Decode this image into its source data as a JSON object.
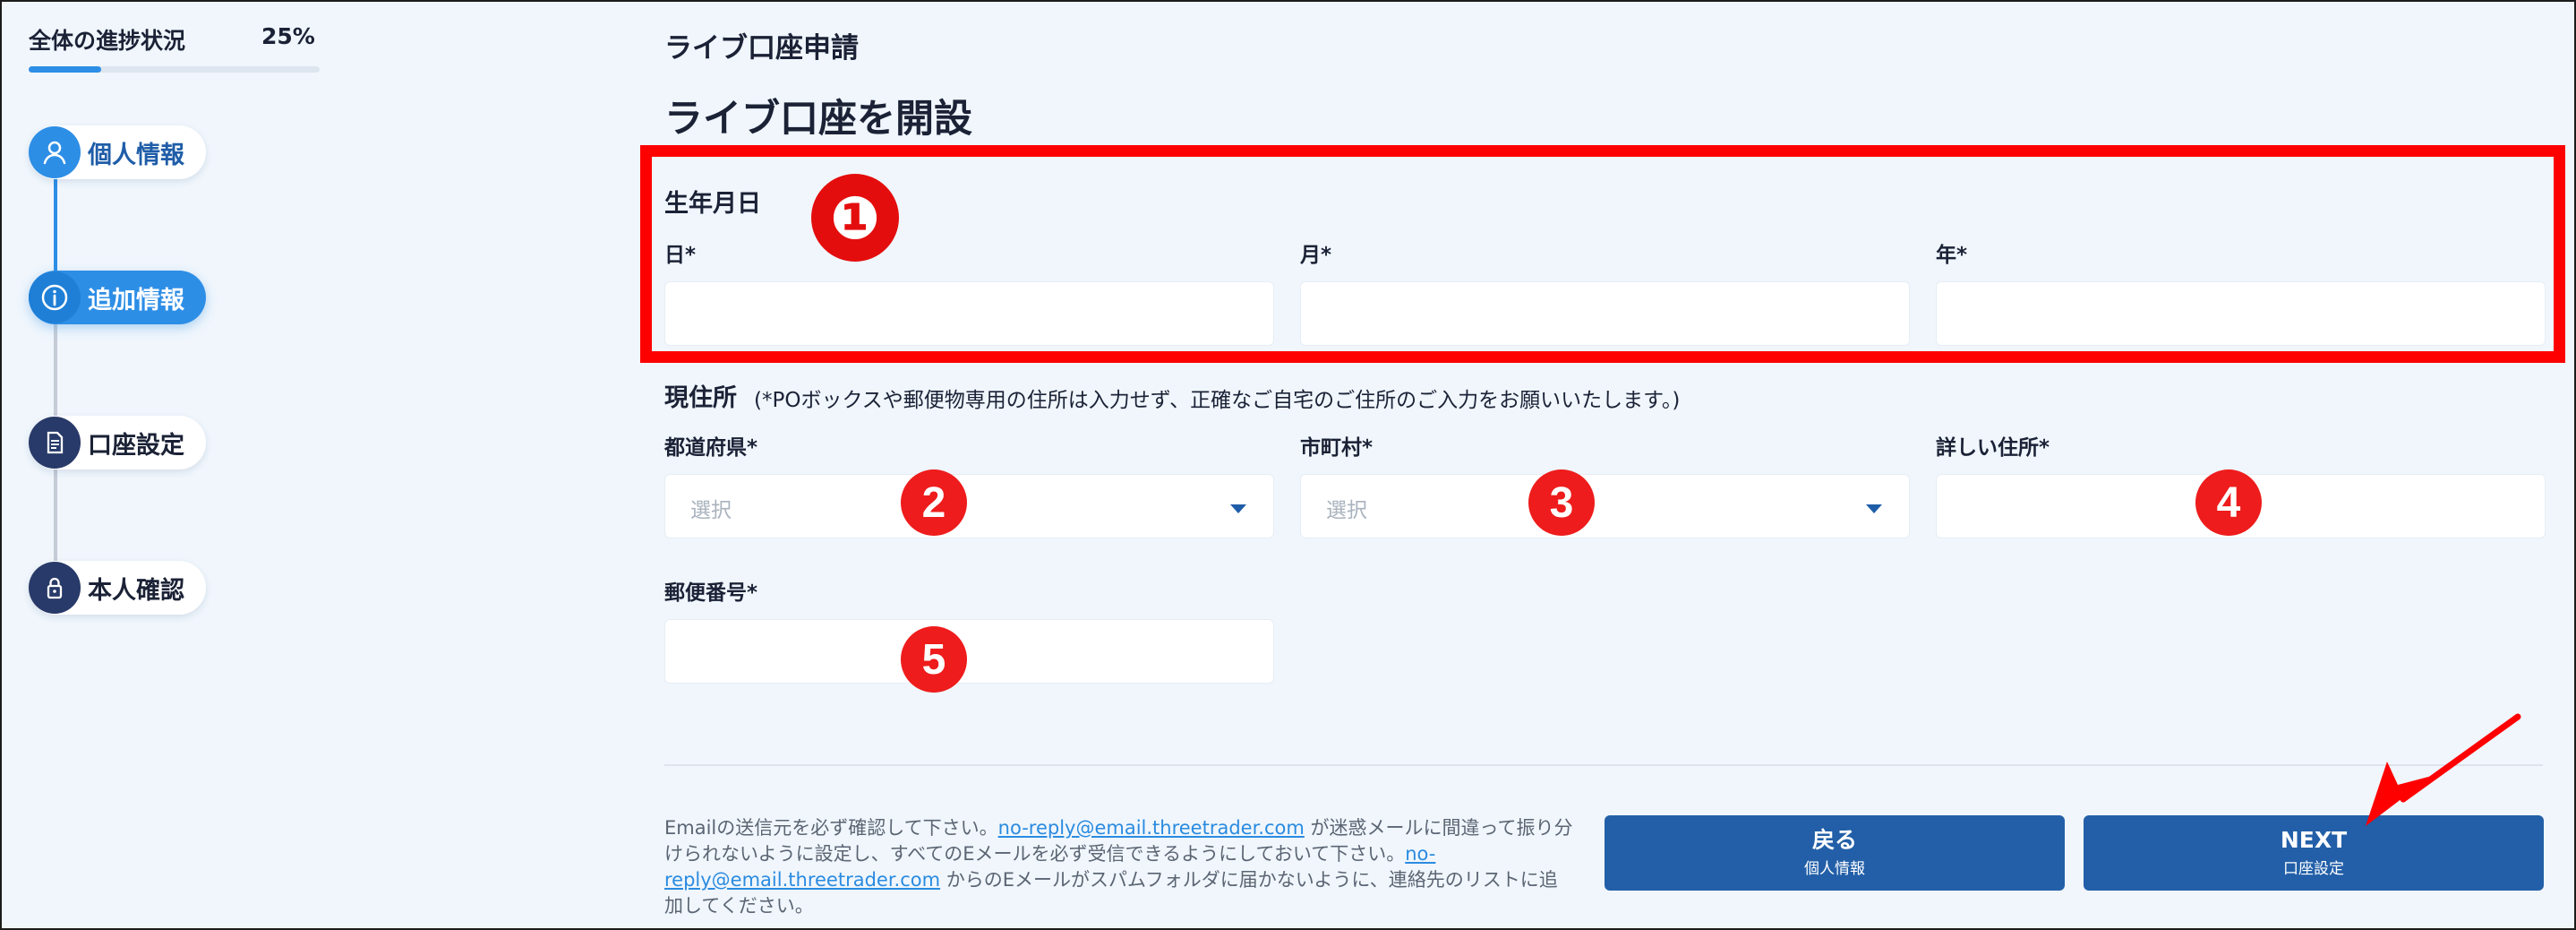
{
  "sidebar": {
    "progress_label": "全体の進捗状況",
    "progress_value": "25%",
    "progress_fraction": 0.25,
    "steps": [
      {
        "label": "個人情報",
        "icon": "user-icon",
        "state": "completed"
      },
      {
        "label": "追加情報",
        "icon": "info-icon",
        "state": "active"
      },
      {
        "label": "口座設定",
        "icon": "document-icon",
        "state": "pending"
      },
      {
        "label": "本人確認",
        "icon": "lock-icon",
        "state": "pending"
      }
    ]
  },
  "main": {
    "breadcrumb": "ライブ口座申請",
    "title": "ライブ口座を開設",
    "birthdate": {
      "section_label": "生年月日",
      "day_label": "日*",
      "month_label": "月*",
      "year_label": "年*",
      "day_value": "",
      "month_value": "",
      "year_value": ""
    },
    "address": {
      "section_label": "現住所",
      "note": "(*POボックスや郵便物専用の住所は入力せず、正確なご自宅のご住所のご入力をお願いいたします。)",
      "prefecture_label": "都道府県*",
      "prefecture_value": "選択",
      "city_label": "市町村*",
      "city_value": "選択",
      "detail_label": "詳しい住所*",
      "detail_value": "",
      "postal_label": "郵便番号*",
      "postal_value": ""
    },
    "markers": [
      "❶",
      "2",
      "3",
      "4",
      "5"
    ]
  },
  "footer": {
    "note_part1": "Emailの送信元を必ず確認して下さい。",
    "email_link_1": "no-reply@email.threetrader.com",
    "note_part2": " が迷惑メールに間違って振り分けられないように設定し、すべてのEメールを必ず受信できるようにしておいて下さい。",
    "email_link_2": "no-reply@email.threetrader.com",
    "note_part3": " からのEメールがスパムフォルダに届かないように、連絡先のリストに追加してください。",
    "back_button": {
      "main": "戻る",
      "sub": "個人情報"
    },
    "next_button": {
      "main": "NEXT",
      "sub": "口座設定"
    }
  },
  "colors": {
    "accent": "#2d8ee6",
    "button": "#225fa8",
    "annotation": "#ff0000",
    "background": "#f0f6fc"
  }
}
